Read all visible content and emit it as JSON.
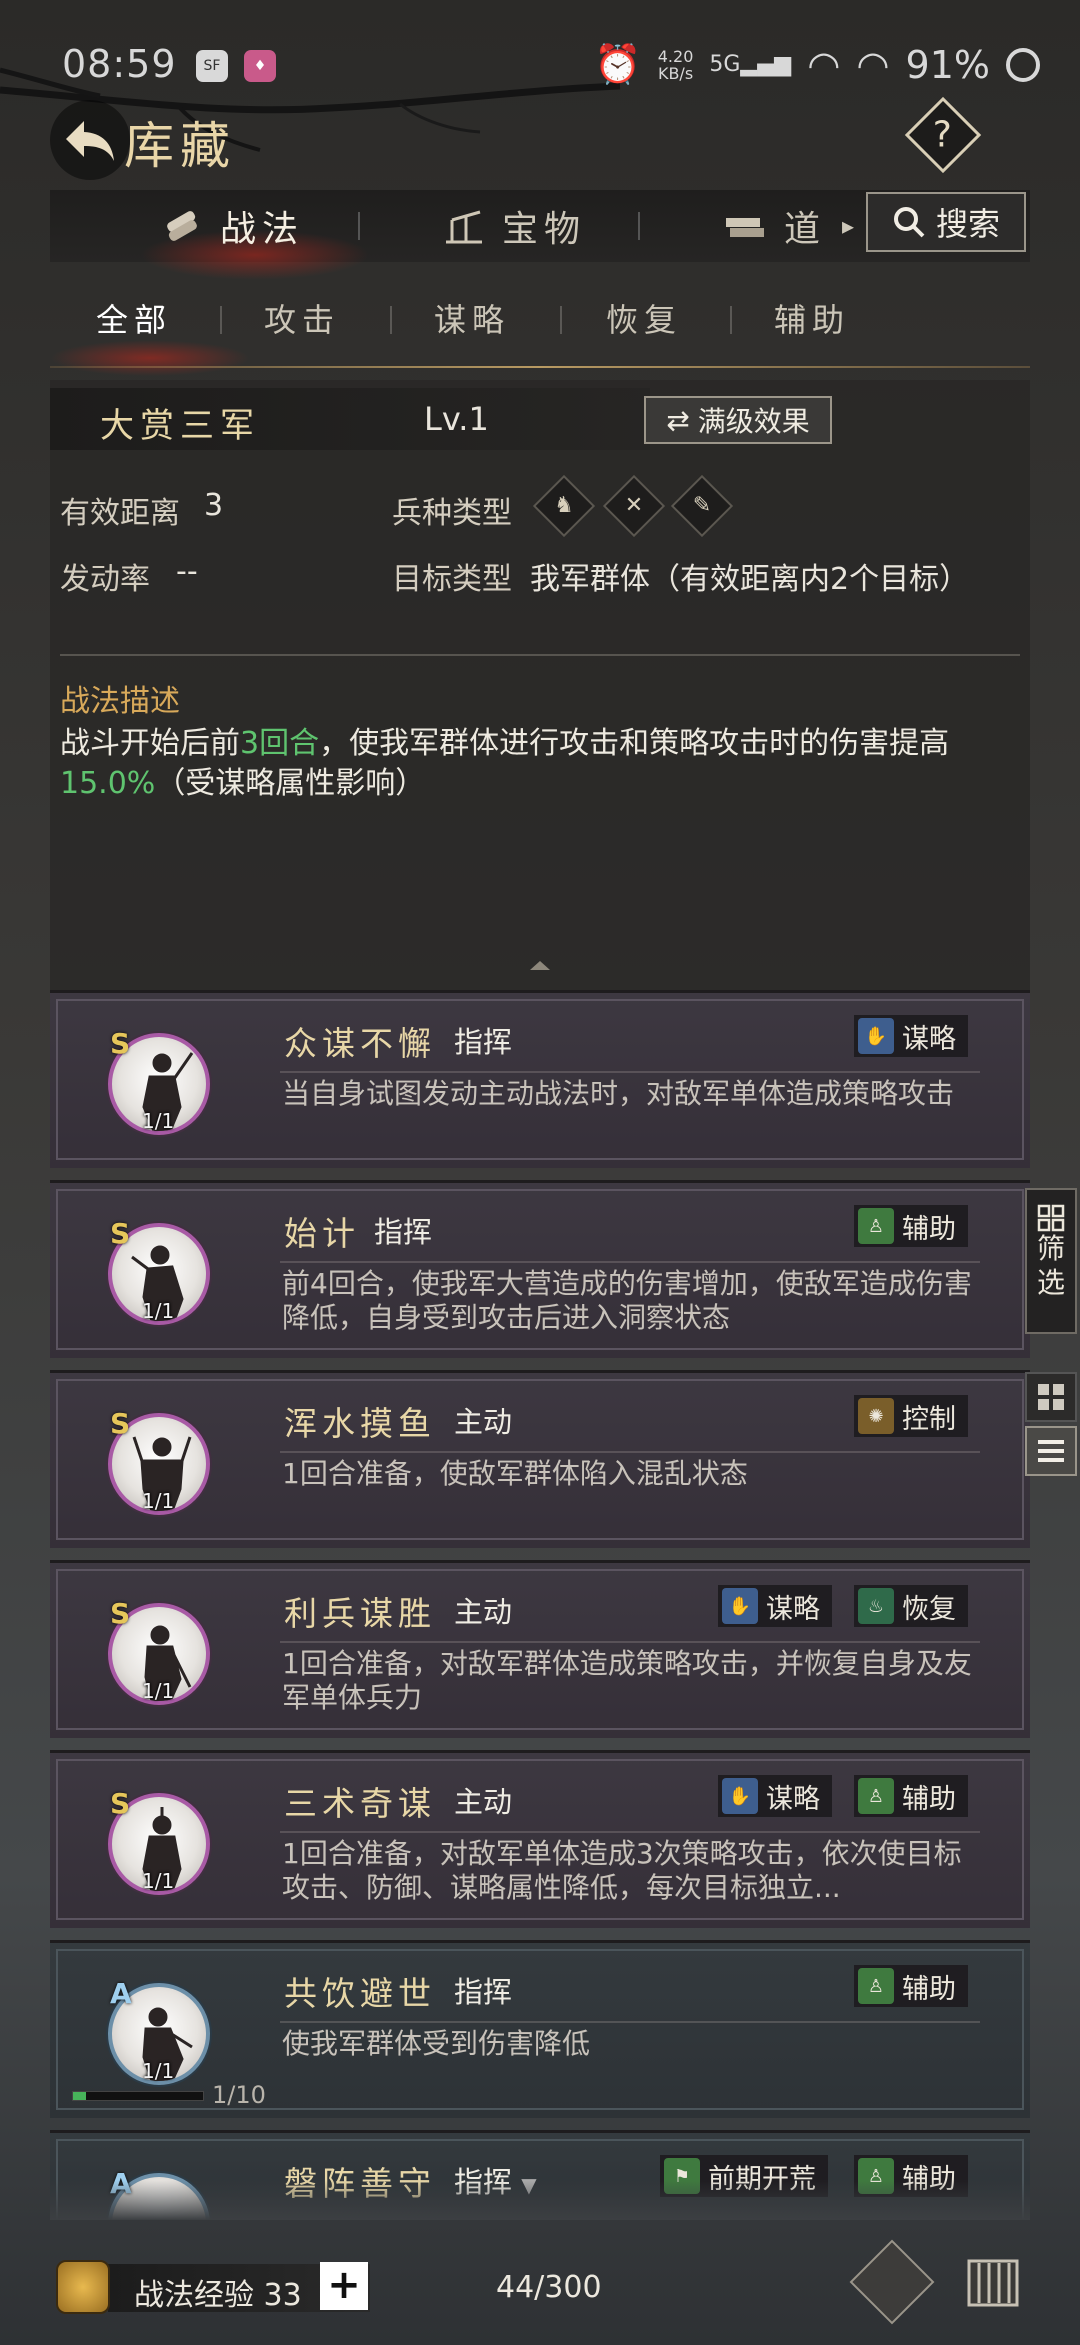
{
  "status_bar": {
    "time": "08:59",
    "net_speed": "4.20",
    "net_unit": "KB/s",
    "signal_label": "5G",
    "battery": "91%"
  },
  "header": {
    "title": "库藏",
    "help_label": "?"
  },
  "top_tabs": [
    {
      "label": "战法",
      "icon": "scroll-bundle-icon",
      "active": true
    },
    {
      "label": "宝物",
      "icon": "weapon-rack-icon",
      "active": false
    },
    {
      "label": "道",
      "icon": "book-stack-icon",
      "active": false
    }
  ],
  "search": {
    "label": "搜索"
  },
  "sub_tabs": [
    {
      "label": "全部",
      "active": true
    },
    {
      "label": "攻击",
      "active": false
    },
    {
      "label": "谋略",
      "active": false
    },
    {
      "label": "恢复",
      "active": false
    },
    {
      "label": "辅助",
      "active": false
    }
  ],
  "detail": {
    "name": "大赏三军",
    "level": "Lv.1",
    "max_effect_label": "满级效果",
    "range_label": "有效距离",
    "range_value": "3",
    "rate_label": "发动率",
    "rate_value": "--",
    "troop_label": "兵种类型",
    "target_label": "目标类型",
    "target_value": "我军群体（有效距离内2个目标）",
    "desc_title": "战法描述",
    "desc_before": "战斗开始后前",
    "desc_hl1": "3回合",
    "desc_mid": "，使我军群体进行攻击和策略攻击时的伤害提高",
    "desc_hl2": "15.0%",
    "desc_after": "（受谋略属性影响）"
  },
  "cards": [
    {
      "grade": "S",
      "count": "1/1",
      "name": "众谋不懈",
      "type": "指挥",
      "tags": [
        {
          "label": "谋略",
          "icon": "strategy-icon"
        }
      ],
      "desc": "当自身试图发动主动战法时，对敌军单体造成策略攻击"
    },
    {
      "grade": "S",
      "count": "1/1",
      "name": "始计",
      "type": "指挥",
      "tags": [
        {
          "label": "辅助",
          "icon": "support-icon"
        }
      ],
      "desc": "前4回合，使我军大营造成的伤害增加，使敌军造成伤害降低，自身受到攻击后进入洞察状态"
    },
    {
      "grade": "S",
      "count": "1/1",
      "name": "浑水摸鱼",
      "type": "主动",
      "tags": [
        {
          "label": "控制",
          "icon": "control-icon"
        }
      ],
      "desc": "1回合准备，使敌军群体陷入混乱状态"
    },
    {
      "grade": "S",
      "count": "1/1",
      "name": "利兵谋胜",
      "type": "主动",
      "tags": [
        {
          "label": "谋略",
          "icon": "strategy-icon"
        },
        {
          "label": "恢复",
          "icon": "recover-icon"
        }
      ],
      "desc": "1回合准备，对敌军群体造成策略攻击，并恢复自身及友军单体兵力"
    },
    {
      "grade": "S",
      "count": "1/1",
      "name": "三术奇谋",
      "type": "主动",
      "tags": [
        {
          "label": "谋略",
          "icon": "strategy-icon"
        },
        {
          "label": "辅助",
          "icon": "support-icon"
        }
      ],
      "desc": "1回合准备，对敌军单体造成3次策略攻击，依次使目标攻击、防御、谋略属性降低，每次目标独立..."
    },
    {
      "grade": "A",
      "count": "1/1",
      "name": "共饮避世",
      "type": "指挥",
      "tags": [
        {
          "label": "辅助",
          "icon": "support-icon"
        }
      ],
      "desc": "使我军群体受到伤害降低",
      "progress_text": "1/10",
      "progress": 0.1
    },
    {
      "grade": "A",
      "count": "",
      "name": "磐阵善守",
      "type": "指挥",
      "tags": [
        {
          "label": "前期开荒",
          "icon": "early-game-icon"
        },
        {
          "label": "辅助",
          "icon": "support-icon"
        }
      ],
      "desc": ""
    }
  ],
  "side": {
    "filter_label_1": "筛",
    "filter_label_2": "选"
  },
  "bottom": {
    "xp_label": "战法经验 33",
    "plus_label": "+",
    "capacity": "44/300"
  }
}
